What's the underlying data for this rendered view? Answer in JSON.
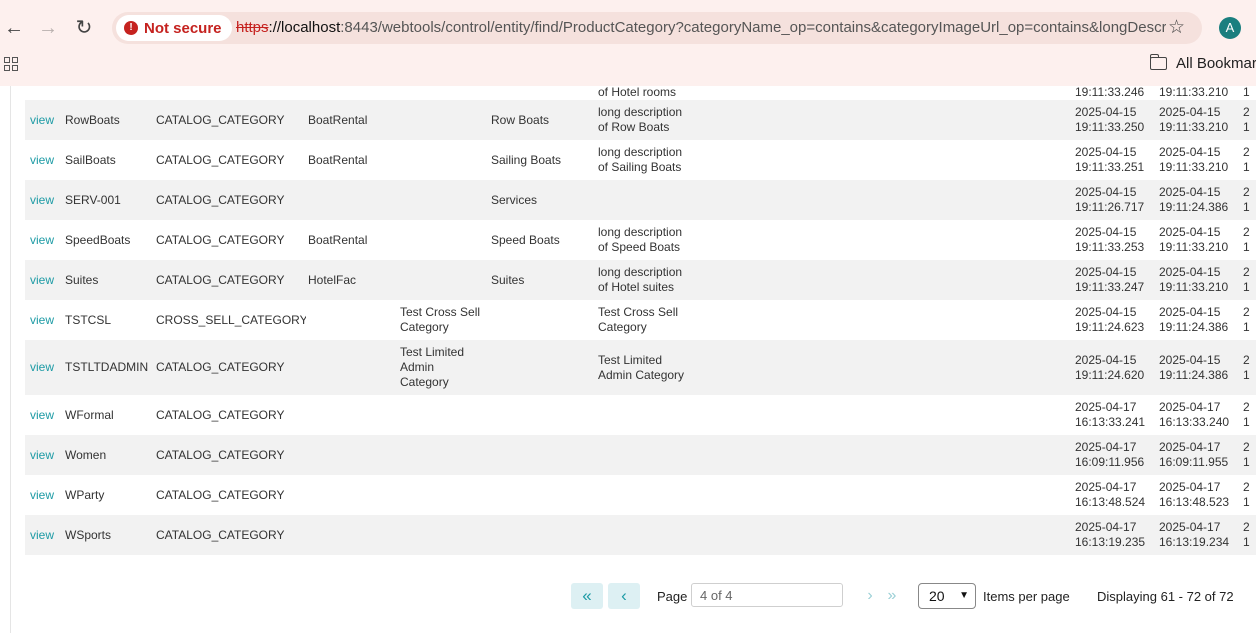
{
  "browser": {
    "security_label": "Not secure",
    "url_scheme": "https",
    "url_host": "://localhost",
    "url_rest": ":8443/webtools/control/entity/find/ProductCategory?categoryName_op=contains&categoryImageUrl_op=contains&longDescri...",
    "avatar_letter": "A",
    "bookmarks_label": "All Bookmarks",
    "icons": {
      "back": "back-arrow-icon",
      "forward": "forward-arrow-icon",
      "reload": "reload-icon",
      "star": "star-icon",
      "apps": "apps-grid-icon",
      "folder": "folder-icon"
    }
  },
  "top_partial_row": {
    "long_description": "of Hotel rooms",
    "created_stamp": "19:11:33.246",
    "last_updated_stamp": "19:11:33.210",
    "col3": "1"
  },
  "rows": [
    {
      "view": "view",
      "id": "RowBoats",
      "type": "CATALOG_CATEGORY",
      "parent": "BoatRental",
      "name": "",
      "description": "Row Boats",
      "long_1": "long description",
      "long_2": "of Row Boats",
      "t1_date": "2025-04-15",
      "t1_time": "19:11:33.250",
      "t2_date": "2025-04-15",
      "t2_time": "19:11:33.210",
      "t3_date": "2",
      "t3_time": "1"
    },
    {
      "view": "view",
      "id": "SailBoats",
      "type": "CATALOG_CATEGORY",
      "parent": "BoatRental",
      "name": "",
      "description": "Sailing Boats",
      "long_1": "long description",
      "long_2": "of Sailing Boats",
      "t1_date": "2025-04-15",
      "t1_time": "19:11:33.251",
      "t2_date": "2025-04-15",
      "t2_time": "19:11:33.210",
      "t3_date": "2",
      "t3_time": "1"
    },
    {
      "view": "view",
      "id": "SERV-001",
      "type": "CATALOG_CATEGORY",
      "parent": "",
      "name": "",
      "description": "Services",
      "long_1": "",
      "long_2": "",
      "t1_date": "2025-04-15",
      "t1_time": "19:11:26.717",
      "t2_date": "2025-04-15",
      "t2_time": "19:11:24.386",
      "t3_date": "2",
      "t3_time": "1"
    },
    {
      "view": "view",
      "id": "SpeedBoats",
      "type": "CATALOG_CATEGORY",
      "parent": "BoatRental",
      "name": "",
      "description": "Speed Boats",
      "long_1": "long description",
      "long_2": "of Speed Boats",
      "t1_date": "2025-04-15",
      "t1_time": "19:11:33.253",
      "t2_date": "2025-04-15",
      "t2_time": "19:11:33.210",
      "t3_date": "2",
      "t3_time": "1"
    },
    {
      "view": "view",
      "id": "Suites",
      "type": "CATALOG_CATEGORY",
      "parent": "HotelFac",
      "name": "",
      "description": "Suites",
      "long_1": "long description",
      "long_2": "of Hotel suites",
      "t1_date": "2025-04-15",
      "t1_time": "19:11:33.247",
      "t2_date": "2025-04-15",
      "t2_time": "19:11:33.210",
      "t3_date": "2",
      "t3_time": "1"
    },
    {
      "view": "view",
      "id": "TSTCSL",
      "type": "CROSS_SELL_CATEGORY",
      "parent": "",
      "name": "Test Cross Sell|Category",
      "description": "",
      "long_1": "Test Cross Sell",
      "long_2": "Category",
      "t1_date": "2025-04-15",
      "t1_time": "19:11:24.623",
      "t2_date": "2025-04-15",
      "t2_time": "19:11:24.386",
      "t3_date": "2",
      "t3_time": "1"
    },
    {
      "view": "view",
      "id": "TSTLTDADMIN",
      "type": "CATALOG_CATEGORY",
      "parent": "",
      "name": "Test Limited|Admin|Category",
      "description": "",
      "long_1": "Test Limited",
      "long_2": "Admin Category",
      "t1_date": "2025-04-15",
      "t1_time": "19:11:24.620",
      "t2_date": "2025-04-15",
      "t2_time": "19:11:24.386",
      "t3_date": "2",
      "t3_time": "1"
    },
    {
      "view": "view",
      "id": "WFormal",
      "type": "CATALOG_CATEGORY",
      "parent": "",
      "name": "",
      "description": "",
      "long_1": "",
      "long_2": "",
      "t1_date": "2025-04-17",
      "t1_time": "16:13:33.241",
      "t2_date": "2025-04-17",
      "t2_time": "16:13:33.240",
      "t3_date": "2",
      "t3_time": "1"
    },
    {
      "view": "view",
      "id": "Women",
      "type": "CATALOG_CATEGORY",
      "parent": "",
      "name": "",
      "description": "",
      "long_1": "",
      "long_2": "",
      "t1_date": "2025-04-17",
      "t1_time": "16:09:11.956",
      "t2_date": "2025-04-17",
      "t2_time": "16:09:11.955",
      "t3_date": "2",
      "t3_time": "1"
    },
    {
      "view": "view",
      "id": "WParty",
      "type": "CATALOG_CATEGORY",
      "parent": "",
      "name": "",
      "description": "",
      "long_1": "",
      "long_2": "",
      "t1_date": "2025-04-17",
      "t1_time": "16:13:48.524",
      "t2_date": "2025-04-17",
      "t2_time": "16:13:48.523",
      "t3_date": "2",
      "t3_time": "1"
    },
    {
      "view": "view",
      "id": "WSports",
      "type": "CATALOG_CATEGORY",
      "parent": "",
      "name": "",
      "description": "",
      "long_1": "",
      "long_2": "",
      "t1_date": "2025-04-17",
      "t1_time": "16:13:19.235",
      "t2_date": "2025-04-17",
      "t2_time": "16:13:19.234",
      "t3_date": "2",
      "t3_time": "1"
    }
  ],
  "pagination": {
    "first_icon": "double-chevron-left-icon",
    "prev_icon": "chevron-left-icon",
    "next_icon": "chevron-right-icon",
    "last_icon": "double-chevron-right-icon",
    "page_label": "Page",
    "page_value": "4 of 4",
    "items_per_page_value": "20",
    "items_per_page_label": "Items per page",
    "displaying": "Displaying 61 - 72 of 72"
  },
  "colors": {
    "link": "#1d9ba5",
    "row_alt": "#f2f2f2",
    "chrome_bg": "#fdf0ee",
    "warning": "#c5221f"
  }
}
